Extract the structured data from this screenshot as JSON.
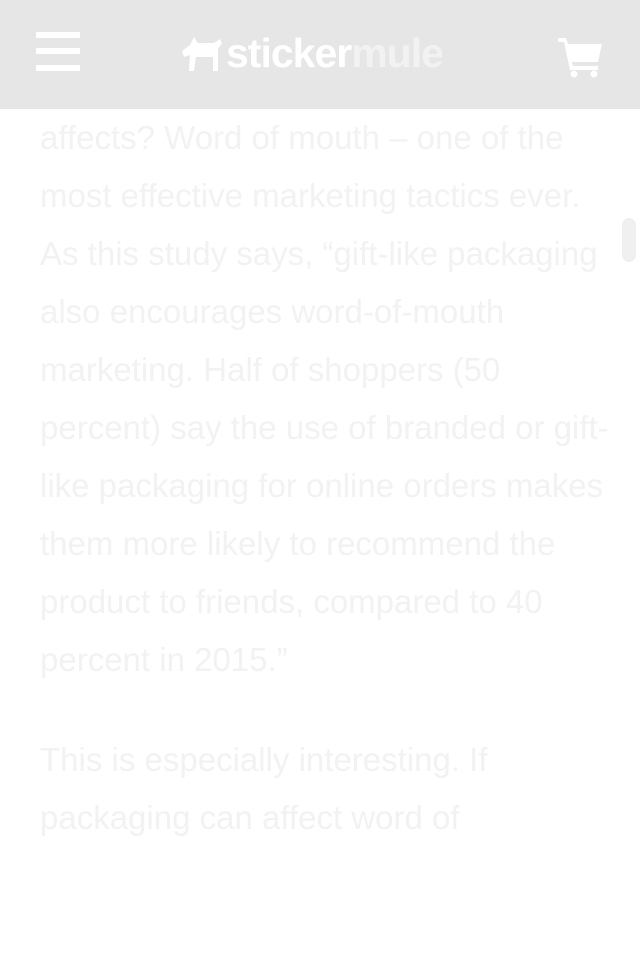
{
  "header": {
    "logo_sticker": "sticker",
    "logo_mule": "mule",
    "menu_icon": "hamburger-menu-icon",
    "cart_icon": "shopping-cart-icon",
    "background_color": "#e6e6e6"
  },
  "article": {
    "paragraphs": [
      "affects? Word of mouth – one of the most effective marketing tactics ever. As this study says, “gift-like packaging also encourages word-of-mouth marketing. Half of shoppers (50 percent) say the use of branded or gift-like packaging for online orders makes them more likely to recommend the product to friends, compared to 40 percent in 2015.”",
      "This is especially interesting. If packaging can affect word of"
    ],
    "text_color": "#f2f2f2"
  }
}
